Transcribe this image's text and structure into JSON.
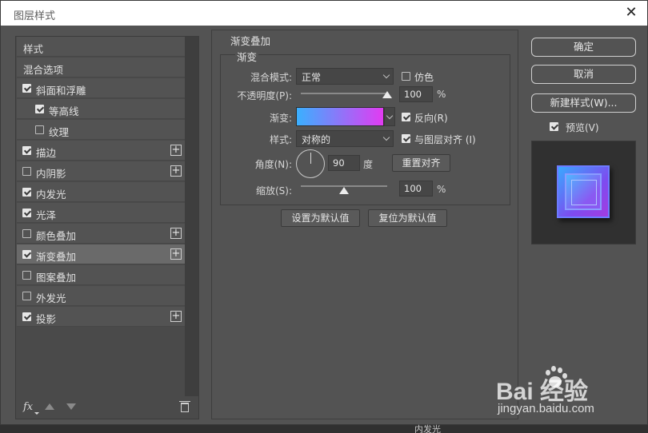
{
  "window": {
    "title": "图层样式"
  },
  "left_list": {
    "items": [
      {
        "label": "样式",
        "type": "header",
        "checked": null,
        "plus": false,
        "selected": false
      },
      {
        "label": "混合选项",
        "type": "header",
        "checked": null,
        "plus": false,
        "selected": false
      },
      {
        "label": "斜面和浮雕",
        "type": "item",
        "checked": true,
        "plus": false,
        "selected": false
      },
      {
        "label": "等高线",
        "type": "sub",
        "checked": true,
        "plus": false,
        "selected": false
      },
      {
        "label": "纹理",
        "type": "sub",
        "checked": false,
        "plus": false,
        "selected": false
      },
      {
        "label": "描边",
        "type": "item",
        "checked": true,
        "plus": true,
        "selected": false
      },
      {
        "label": "内阴影",
        "type": "item",
        "checked": false,
        "plus": true,
        "selected": false
      },
      {
        "label": "内发光",
        "type": "item",
        "checked": true,
        "plus": false,
        "selected": false
      },
      {
        "label": "光泽",
        "type": "item",
        "checked": true,
        "plus": false,
        "selected": false
      },
      {
        "label": "颜色叠加",
        "type": "item",
        "checked": false,
        "plus": true,
        "selected": false
      },
      {
        "label": "渐变叠加",
        "type": "item",
        "checked": true,
        "plus": true,
        "selected": true
      },
      {
        "label": "图案叠加",
        "type": "item",
        "checked": false,
        "plus": false,
        "selected": false
      },
      {
        "label": "外发光",
        "type": "item",
        "checked": false,
        "plus": false,
        "selected": false
      },
      {
        "label": "投影",
        "type": "item",
        "checked": true,
        "plus": true,
        "selected": false
      }
    ],
    "footer": {
      "fx_label": "fx"
    }
  },
  "panel": {
    "section_title": "渐变叠加",
    "group_title": "渐变",
    "blend_mode": {
      "label": "混合模式:",
      "value": "正常"
    },
    "dither": {
      "label": "仿色",
      "checked": false
    },
    "opacity": {
      "label": "不透明度(P):",
      "value": "100",
      "unit": "%",
      "level": 1.0
    },
    "gradient": {
      "label": "渐变:",
      "colors": [
        "#3ab0ff",
        "#e23bf2"
      ]
    },
    "reverse": {
      "label": "反向(R)",
      "checked": true
    },
    "style": {
      "label": "样式:",
      "value": "对称的"
    },
    "align": {
      "label": "与图层对齐 (I)",
      "checked": true
    },
    "angle": {
      "label": "角度(N):",
      "value": "90",
      "unit": "度"
    },
    "reset_align_button": "重置对齐",
    "scale": {
      "label": "缩放(S):",
      "value": "100",
      "unit": "%",
      "level": 0.5
    },
    "set_default_button": "设置为默认值",
    "reset_default_button": "复位为默认值"
  },
  "right": {
    "ok_button": "确定",
    "cancel_button": "取消",
    "new_style_button": "新建样式(W)...",
    "preview": {
      "label": "预览(V)",
      "checked": true
    }
  },
  "background": {
    "layer_text": "内发光"
  },
  "watermark": {
    "logo": "Bai 经验",
    "url": "jingyan.baidu.com"
  }
}
